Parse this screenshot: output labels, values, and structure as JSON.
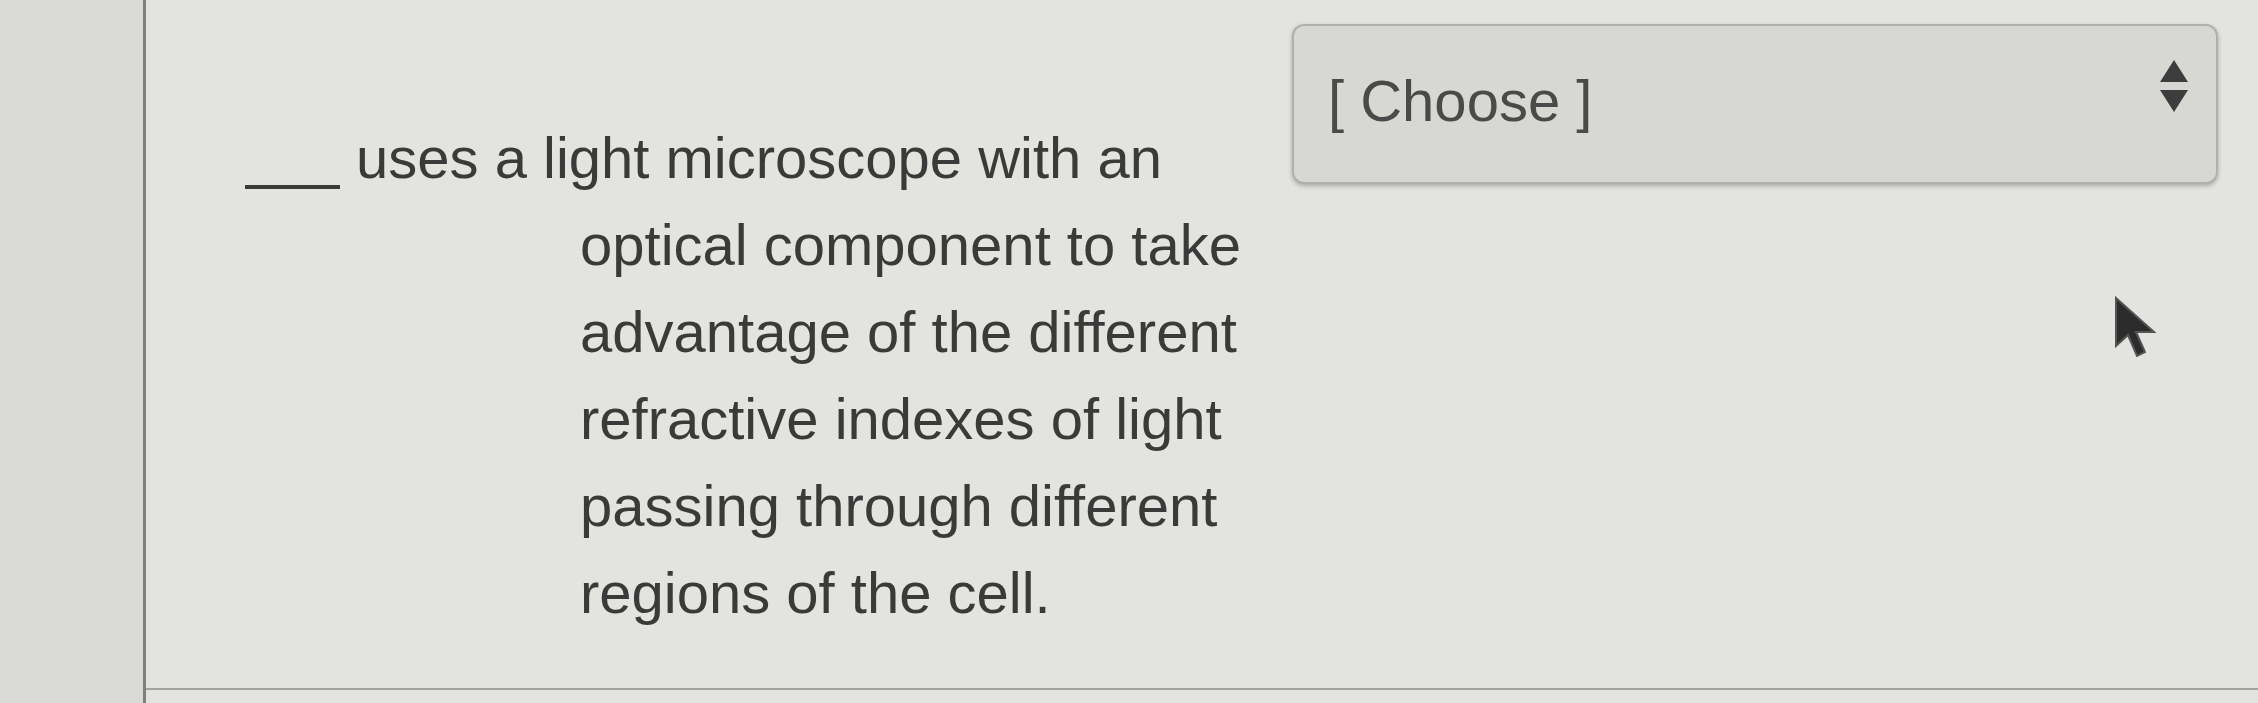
{
  "question": {
    "text_lines": [
      "uses a light microscope with an",
      "optical component to take",
      "advantage of the different",
      "refractive indexes of light",
      "passing through different",
      "regions of the cell."
    ]
  },
  "answer_dropdown": {
    "value": "[ Choose ]"
  }
}
